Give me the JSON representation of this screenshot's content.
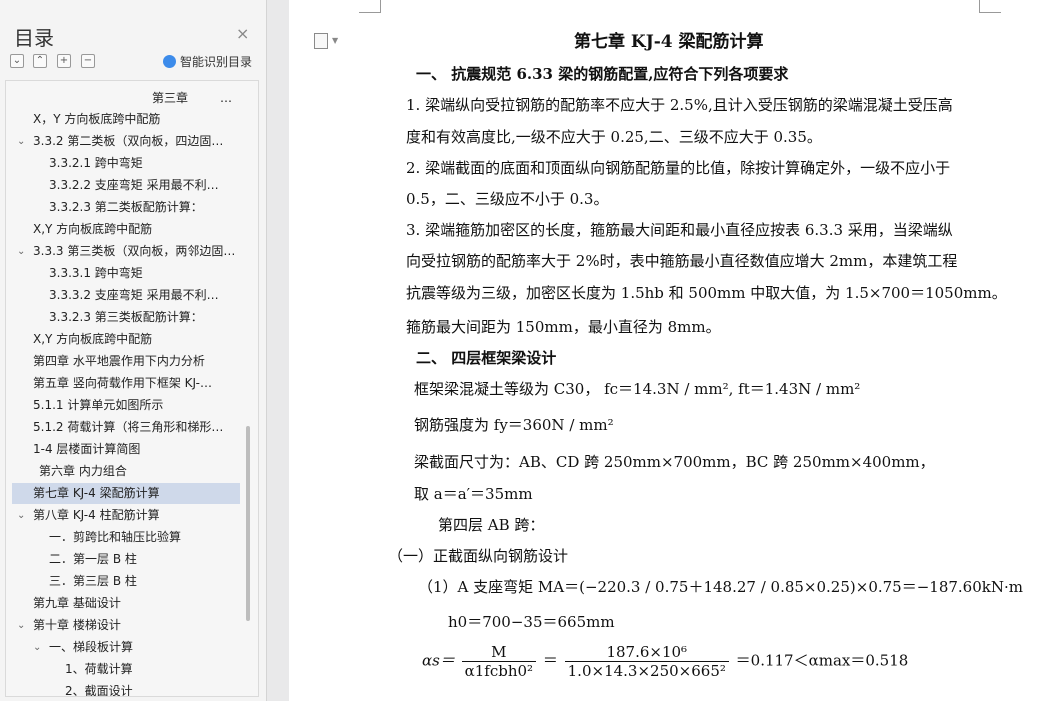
{
  "sidebar": {
    "title": "目录",
    "close_glyph": "×",
    "smart_toc_label": "智能识别目录",
    "tools": [
      "⌄",
      "⌃",
      "+",
      "−"
    ],
    "items": [
      {
        "label": "第三章",
        "extra": "…",
        "chevron": ""
      },
      {
        "label": "X，Y 方向板底跨中配筋",
        "chevron": ""
      },
      {
        "label": "3.3.2  第二类板（双向板，四边固…",
        "chevron": "⌄"
      },
      {
        "label": "3.3.2.1  跨中弯矩",
        "chevron": ""
      },
      {
        "label": "3.3.2.2  支座弯矩    采用最不利…",
        "chevron": ""
      },
      {
        "label": "3.3.2.3    第二类板配筋计算：",
        "chevron": ""
      },
      {
        "label": "X,Y 方向板底跨中配筋",
        "chevron": ""
      },
      {
        "label": "3.3.3 第三类板（双向板，两邻边固…",
        "chevron": "⌄"
      },
      {
        "label": "3.3.3.1 跨中弯矩",
        "chevron": ""
      },
      {
        "label": "3.3.3.2  支座弯矩    采用最不利…",
        "chevron": ""
      },
      {
        "label": "3.3.2.3    第三类板配筋计算：",
        "chevron": ""
      },
      {
        "label": "X,Y 方向板底跨中配筋",
        "chevron": ""
      },
      {
        "label": "第四章    水平地震作用下内力分析",
        "chevron": ""
      },
      {
        "label": "第五章    竖向荷载作用下框架 KJ-…",
        "chevron": ""
      },
      {
        "label": "5.1.1 计算单元如图所示",
        "chevron": ""
      },
      {
        "label": "5.1.2  荷载计算（将三角形和梯形…",
        "chevron": ""
      },
      {
        "label": "1-4 层楼面计算简图",
        "chevron": ""
      },
      {
        "label": "第六章    内力组合",
        "chevron": ""
      },
      {
        "label": "第七章    KJ-4 梁配筋计算",
        "chevron": ""
      },
      {
        "label": "第八章   KJ-4 柱配筋计算",
        "chevron": "⌄"
      },
      {
        "label": "一．剪跨比和轴压比验算",
        "chevron": ""
      },
      {
        "label": "二．第一层    B 柱",
        "chevron": ""
      },
      {
        "label": "三．第三层    B 柱",
        "chevron": ""
      },
      {
        "label": "第九章    基础设计",
        "chevron": ""
      },
      {
        "label": "第十章    楼梯设计",
        "chevron": "⌄"
      },
      {
        "label": "一、梯段板计算",
        "chevron": "⌄"
      },
      {
        "label": "1、荷载计算",
        "chevron": ""
      },
      {
        "label": "2、截面设计",
        "chevron": ""
      }
    ],
    "active_item": "第七章    KJ-4 梁配筋计算"
  },
  "document": {
    "title": "第七章      KJ-4 梁配筋计算",
    "section1_heading": "一、     抗震规范 6.33 梁的钢筋配置,应符合下列各项要求",
    "p1_line1": "1.    梁端纵向受拉钢筋的配筋率不应大于 2.5%,且计入受压钢筋的梁端混凝土受压高",
    "p1_line2": "度和有效高度比,一级不应大于 0.25,二、三级不应大于 0.35。",
    "p2_line1": "2.    梁端截面的底面和顶面纵向钢筋配筋量的比值，除按计算确定外，一级不应小于",
    "p2_line2": "0.5，二、三级应不小于 0.3。",
    "p3_line1": "3.    梁端箍筋加密区的长度，箍筋最大间距和最小直径应按表 6.3.3 采用，当梁端纵",
    "p3_line2": "向受拉钢筋的配筋率大于 2%时，表中箍筋最小直径数值应增大 2mm，本建筑工程",
    "p3_line3": "抗震等级为三级，加密区长度为 1.5hb 和 500mm 中取大值，为 1.5×700＝1050mm。",
    "p3_line4": "箍筋最大间距为 150mm，最小直径为 8mm。",
    "section2_heading": "二、     四层框架梁设计",
    "concrete_line": "框架梁混凝土等级为 C30，  fc＝14.3N / mm², ft＝1.43N / mm²",
    "steel_line": "钢筋强度为 fy＝360N / mm²",
    "section_size_line": "梁截面尺寸为：AB、CD 跨 250mm×700mm，BC 跨 250mm×400mm，",
    "a_line": "取 a＝a′＝35mm",
    "floor_span_line": "第四层  AB 跨：",
    "sub_heading": "（一）正截面纵向钢筋设计",
    "moment_line": "（1）A 支座弯矩      MA＝(−220.3 / 0.75＋148.27 / 0.85×0.25)×0.75＝−187.60kN·m",
    "h0_line": "h0＝700−35＝665mm",
    "alpha_lhs": "αs＝",
    "alpha_f1_num": "M",
    "alpha_f1_den": "α1fcbh0²",
    "alpha_eq": "＝",
    "alpha_f2_num": "187.6×10⁶",
    "alpha_f2_den": "1.0×14.3×250×665²",
    "alpha_rhs": "＝0.117＜αmax＝0.518"
  }
}
